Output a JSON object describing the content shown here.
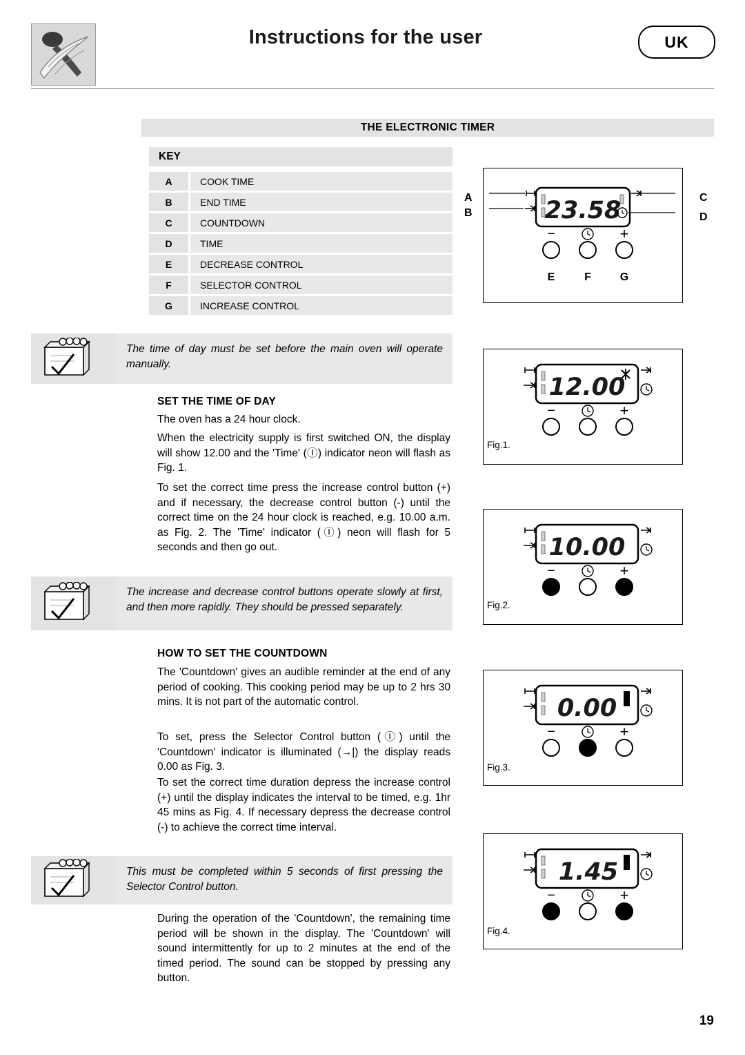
{
  "header": {
    "title": "Instructions for the user",
    "locale_badge": "UK",
    "logo_icon": "spoon-wheat-logo"
  },
  "section": {
    "title": "THE ELECTRONIC TIMER",
    "key_heading": "KEY",
    "key_rows": [
      {
        "letter": "A",
        "label": "COOK TIME"
      },
      {
        "letter": "B",
        "label": "END TIME"
      },
      {
        "letter": "C",
        "label": "COUNTDOWN"
      },
      {
        "letter": "D",
        "label": "TIME"
      },
      {
        "letter": "E",
        "label": "DECREASE CONTROL"
      },
      {
        "letter": "F",
        "label": "SELECTOR CONTROL"
      },
      {
        "letter": "G",
        "label": "INCREASE CONTROL"
      }
    ]
  },
  "notes": [
    {
      "icon": "note-pencil-icon",
      "text": "The time of day must be set before the main oven will operate manually."
    },
    {
      "icon": "note-pencil-icon",
      "text": "The increase and decrease control buttons operate slowly at first, and then more rapidly. They should be pressed separately."
    },
    {
      "icon": "note-pencil-icon",
      "text": "This must be completed within 5 seconds of first pressing the Selector Control button."
    }
  ],
  "body": {
    "set_time_heading": "SET THE TIME OF DAY",
    "p1": "The oven has a 24 hour clock.",
    "p2": "When the electricity supply is first switched ON, the display will show 12.00 and the 'Time' (Ⓘ) indicator neon will flash as Fig. 1.",
    "p3": "To set the correct time press the increase control button (+) and if necessary, the decrease control button (-) until the correct time on the 24 hour clock is reached, e.g. 10.00 a.m. as Fig. 2. The 'Time' indicator (Ⓘ) neon will flash for 5 seconds and then go out.",
    "countdown_heading": "HOW TO SET THE COUNTDOWN",
    "p4": "The 'Countdown' gives an audible reminder at the end of any period of cooking. This cooking period may be up to 2 hrs 30 mins. It is not part of the automatic control.",
    "p5": "To set, press the Selector Control button (Ⓘ) until the 'Countdown' indicator is illuminated (→|) the display reads 0.00 as Fig. 3.",
    "p6": "To set the correct time duration depress the increase control (+) until the display indicates the interval to be timed, e.g. 1hr 45 mins as Fig. 4. If necessary depress the decrease control (-) to achieve the correct time interval.",
    "p7": "During the operation of the 'Countdown', the remaining time period will be shown in the display. The 'Countdown' will sound intermittently for up to 2 minutes at the end of the timed period. The sound can be stopped by pressing any button."
  },
  "figures": {
    "key_diagram": {
      "display_value": "23.58",
      "callouts_left": [
        "A",
        "B"
      ],
      "callouts_right": [
        "C",
        "D"
      ],
      "callouts_bottom": [
        "E",
        "F",
        "G"
      ],
      "button_labels": [
        "−",
        "Ⓘ",
        "+"
      ]
    },
    "fig1": {
      "caption": "Fig.1.",
      "display_value": "12.00",
      "button_labels": [
        "−",
        "Ⓘ",
        "+"
      ]
    },
    "fig2": {
      "caption": "Fig.2.",
      "display_value": "10.00",
      "button_labels": [
        "−",
        "Ⓘ",
        "+"
      ]
    },
    "fig3": {
      "caption": "Fig.3.",
      "display_value": "0.00",
      "button_labels": [
        "−",
        "Ⓘ",
        "+"
      ]
    },
    "fig4": {
      "caption": "Fig.4.",
      "display_value": "1.45",
      "button_labels": [
        "−",
        "Ⓘ",
        "+"
      ]
    }
  },
  "footer": {
    "page_number": "19"
  }
}
